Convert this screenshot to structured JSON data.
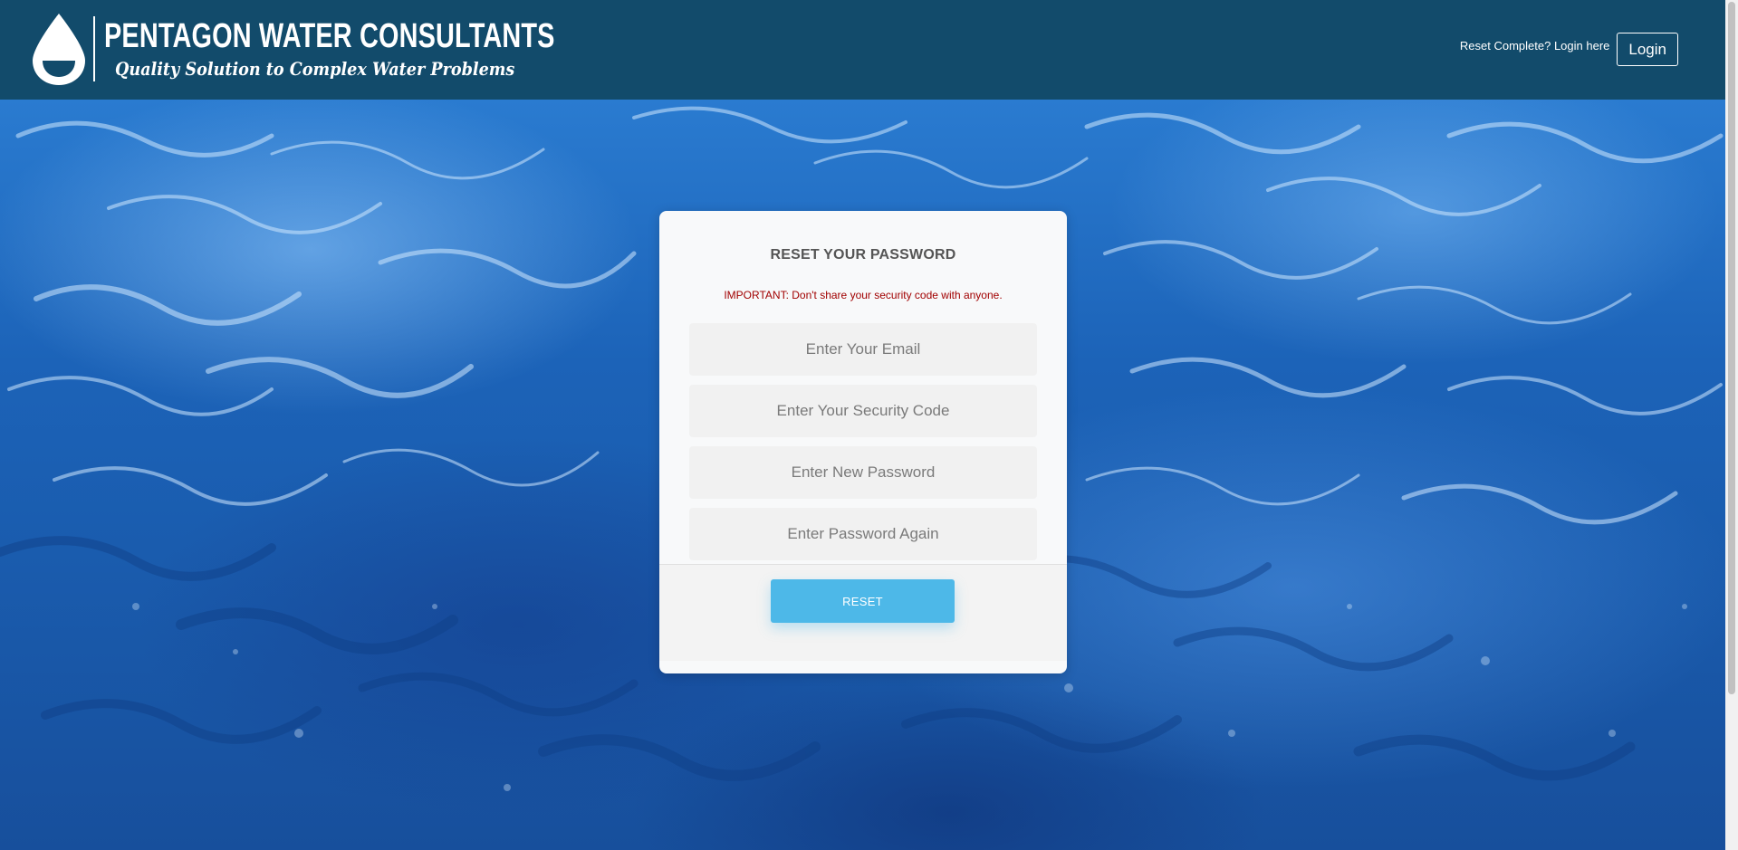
{
  "header": {
    "brand_name": "PENTAGON WATER CONSULTANTS",
    "tagline": "Quality Solution to Complex Water Problems",
    "logo_icon": "water-drop-icon",
    "login_hint": "Reset Complete? Login here",
    "login_label": "Login",
    "background_color": "#124b6b"
  },
  "card": {
    "title": "RESET YOUR PASSWORD",
    "warning": "IMPORTANT: Don't share your security code with anyone.",
    "fields": {
      "email": {
        "value": "",
        "placeholder": "Enter Your Email"
      },
      "security_code": {
        "value": "",
        "placeholder": "Enter Your Security Code"
      },
      "new_password": {
        "value": "",
        "placeholder": "Enter New Password"
      },
      "confirm_password": {
        "value": "",
        "placeholder": "Enter Password Again"
      }
    },
    "reset_label": "RESET",
    "warning_color": "#a10000",
    "button_color": "#4db8e8"
  }
}
